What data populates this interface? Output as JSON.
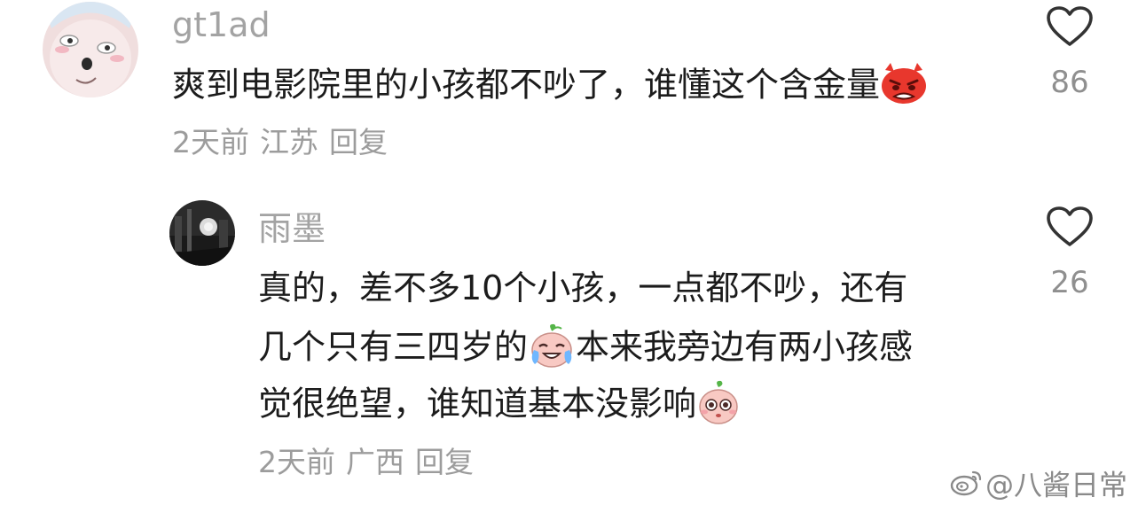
{
  "comments": [
    {
      "username": "gt1ad",
      "text": "爽到电影院里的小孩都不吵了，谁懂这个含金量",
      "time": "2天前",
      "location": "江苏",
      "reply_label": "回复",
      "likes": "86",
      "avatar": "cartoon-face",
      "emoji": "angry-emoji"
    },
    {
      "username": "雨墨",
      "lines": [
        "真的，差不多10个小孩，一点都不吵，还有",
        "几个只有三四岁的",
        "本来我旁边有两小孩感",
        "觉很绝望，谁知道基本没影响"
      ],
      "time": "2天前",
      "location": "广西",
      "reply_label": "回复",
      "likes": "26",
      "avatar": "dark-photo",
      "emojis": [
        "crying-emoji",
        "sprout-eyes-emoji"
      ]
    }
  ],
  "watermark": "@八酱日常",
  "icons": {
    "like": "heart-icon",
    "watermark_logo": "weibo-icon"
  },
  "colors": {
    "text": "#1c1c1c",
    "username": "#a3a3a3",
    "meta": "#9c9c9c",
    "heart_stroke": "#333333"
  }
}
